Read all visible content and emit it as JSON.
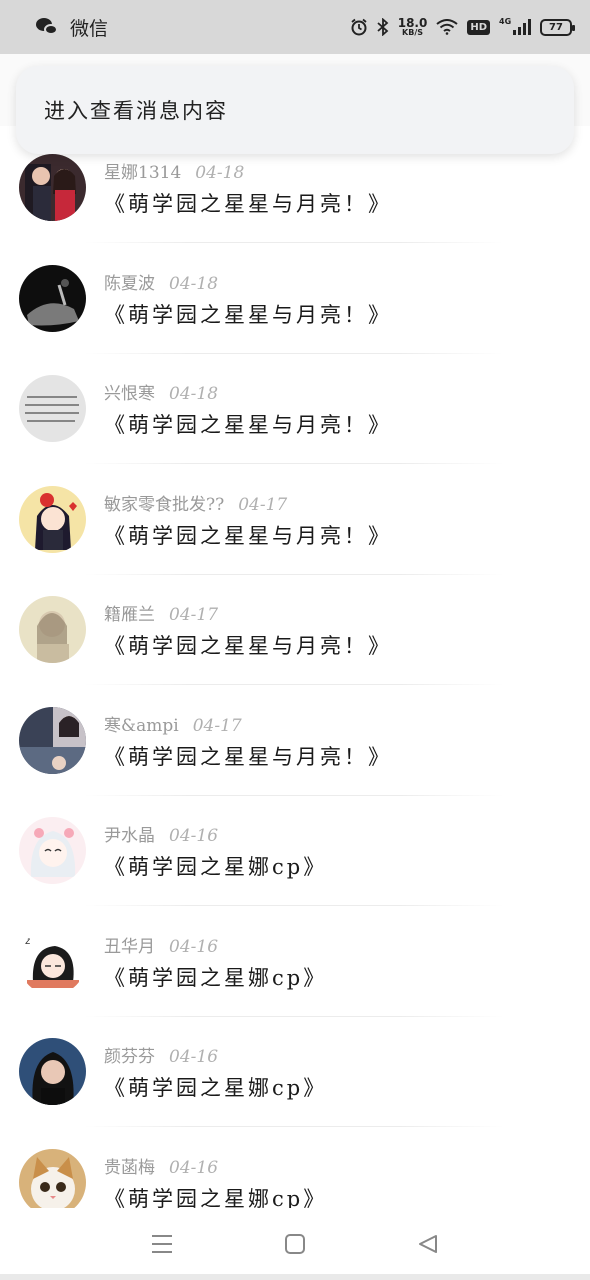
{
  "status_bar": {
    "app_name": "微信",
    "net_speed_value": "18.0",
    "net_speed_unit": "KB/S",
    "hd_label": "HD",
    "network_label": "4G",
    "battery": "77"
  },
  "banner": {
    "text": "进入查看消息内容"
  },
  "messages": [
    {
      "name": "星娜1314",
      "date": "04-18",
      "title": "《萌学园之星星与月亮！》",
      "avatar": "couple-photo-avatar"
    },
    {
      "name": "陈夏波",
      "date": "04-18",
      "title": "《萌学园之星星与月亮！》",
      "avatar": "dark-hand-avatar"
    },
    {
      "name": "兴恨寒",
      "date": "04-18",
      "title": "《萌学园之星星与月亮！》",
      "avatar": "text-note-avatar"
    },
    {
      "name": "敏家零食批发??",
      "date": "04-17",
      "title": "《萌学园之星星与月亮！》",
      "avatar": "cartoon-girl-avatar"
    },
    {
      "name": "籍雁兰",
      "date": "04-17",
      "title": "《萌学园之星星与月亮！》",
      "avatar": "soft-girl-avatar"
    },
    {
      "name": "寒&ampi",
      "date": "04-17",
      "title": "《萌学园之星星与月亮！》",
      "avatar": "girl-collage-avatar"
    },
    {
      "name": "尹水晶",
      "date": "04-16",
      "title": "《萌学园之星娜cp》",
      "avatar": "anime-girl-avatar"
    },
    {
      "name": "丑华月",
      "date": "04-16",
      "title": "《萌学园之星娜cp》",
      "avatar": "sleepy-cartoon-avatar"
    },
    {
      "name": "颜芬芬",
      "date": "04-16",
      "title": "《萌学园之星娜cp》",
      "avatar": "portrait-girl-avatar"
    },
    {
      "name": "贵菡梅",
      "date": "04-16",
      "title": "《萌学园之星娜cp》",
      "avatar": "cat-avatar"
    }
  ],
  "colors": {
    "status_bar_bg": "#d8d8d8",
    "banner_bg": "#f2f3f5",
    "meta_text": "#9a9a9a",
    "title_text": "#1a1a1a"
  },
  "nav_bar": {
    "menu_icon": "menu-lines-icon",
    "home_icon": "square-home-icon",
    "back_icon": "triangle-back-icon"
  }
}
